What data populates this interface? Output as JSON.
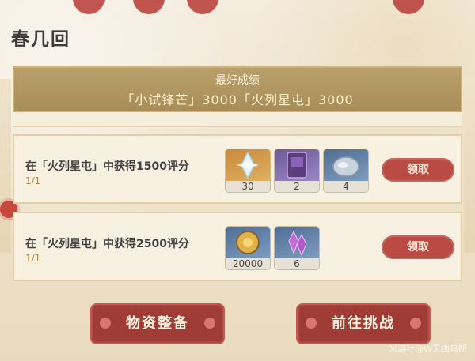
{
  "header": {
    "title": "春几回"
  },
  "best": {
    "title": "最好成绩",
    "scores": "「小试锋芒」3000「火列星屯」3000"
  },
  "tasks": [
    {
      "description": "在「火列星屯」中获得1500评分",
      "progress": "1/1",
      "claim_label": "领取",
      "rewards": [
        {
          "icon": "primogem-icon",
          "count": "30",
          "color": "#c88a3a"
        },
        {
          "icon": "purple-book-icon",
          "count": "2",
          "color": "#6e5a98"
        },
        {
          "icon": "ore-icon",
          "count": "4",
          "color": "#4f6e95"
        }
      ]
    },
    {
      "description": "在「火列星屯」中获得2500评分",
      "progress": "1/1",
      "claim_label": "领取",
      "rewards": [
        {
          "icon": "mora-coin-icon",
          "count": "20000",
          "color": "#4f6e95"
        },
        {
          "icon": "crystal-icon",
          "count": "6",
          "color": "#4f6e95"
        }
      ]
    }
  ],
  "buttons": {
    "prepare": "物资整备",
    "challenge": "前往挑战"
  },
  "watermark": "米游社@W无由乌斯"
}
